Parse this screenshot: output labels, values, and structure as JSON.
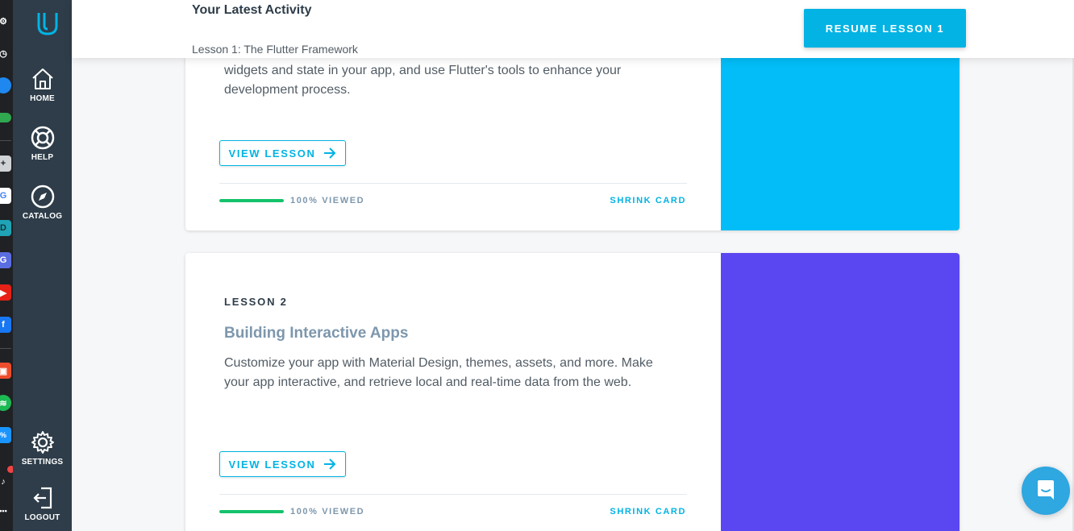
{
  "browser_extensions": [
    {
      "name": "settings-ext-icon",
      "glyph": "⚙",
      "color": "#202124"
    },
    {
      "name": "history-ext-icon",
      "glyph": "◷",
      "color": "#202124"
    },
    {
      "name": "messenger-ext-icon",
      "glyph": "",
      "color": "#1e88f0"
    },
    {
      "name": "gamepad-ext-icon",
      "glyph": "",
      "color": "#2fa84f"
    },
    {
      "name": "add-ext-icon",
      "glyph": "+",
      "color": "#d0d3d6"
    },
    {
      "name": "google-ext-icon",
      "glyph": "G",
      "color": "#ffffff"
    },
    {
      "name": "d-ext-icon",
      "glyph": "D",
      "color": "#1fa3b6"
    },
    {
      "name": "g-ext-icon",
      "glyph": "G",
      "color": "#5b6ee1"
    },
    {
      "name": "youtube-ext-icon",
      "glyph": "",
      "color": "#e62117"
    },
    {
      "name": "facebook-ext-icon",
      "glyph": "f",
      "color": "#1877f2"
    },
    {
      "name": "shopee-ext-icon",
      "glyph": "",
      "color": "#ee4d2d"
    },
    {
      "name": "spotify-ext-icon",
      "glyph": "",
      "color": "#1db954"
    },
    {
      "name": "tiki-ext-icon",
      "glyph": "%",
      "color": "#1a94ff"
    },
    {
      "name": "bell-ext-icon",
      "glyph": "",
      "color": "#202124"
    },
    {
      "name": "more-ext-icon",
      "glyph": "•••",
      "color": "#202124"
    }
  ],
  "sidebar": {
    "home_label": "HOME",
    "help_label": "HELP",
    "catalog_label": "CATALOG",
    "settings_label": "SETTINGS",
    "logout_label": "LOGOUT"
  },
  "header": {
    "title": "Your Latest Activity",
    "subtitle": "Lesson 1: The Flutter Framework",
    "resume_label": "RESUME LESSON 1"
  },
  "lessons": [
    {
      "number": "",
      "title": "",
      "description_line1": "widgets and state in your app, and use Flutter's tools to enhance your",
      "description_line2": "development process.",
      "view_label": "VIEW LESSON",
      "viewed_label": "100% VIEWED",
      "progress": 1.0,
      "shrink_label": "SHRINK CARD",
      "art_color": "#02bdf7"
    },
    {
      "number": "LESSON 2",
      "title": "Building Interactive Apps",
      "description_line1": "Customize your app with Material Design, themes, assets, and more. Make",
      "description_line2": "your app interactive, and retrieve local and real-time data from the web.",
      "view_label": "VIEW LESSON",
      "viewed_label": "100% VIEWED",
      "progress": 1.0,
      "shrink_label": "SHRINK CARD",
      "art_color": "#5a47f2"
    }
  ],
  "colors": {
    "accent": "#02b3e4",
    "sidebar": "#2e3d49",
    "progress": "#15c26b"
  }
}
